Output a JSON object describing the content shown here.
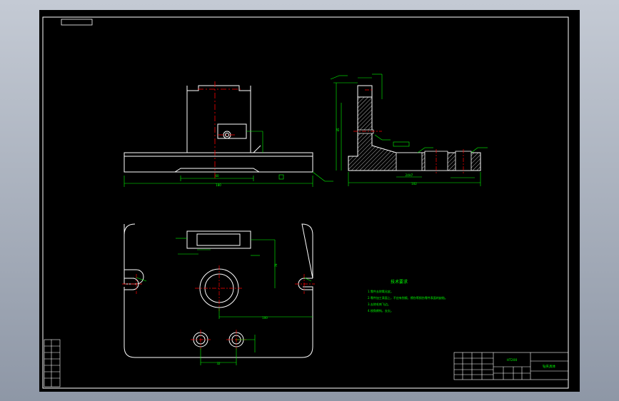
{
  "drawing": {
    "technical_requirements": {
      "heading": "技术要求",
      "items": [
        "1.零件去除氧化皮。",
        "2.零件加工表面上，不应有划痕、擦伤等损伤零件表面的缺陷。",
        "3.去除毛刺飞边。",
        "4.锐角倒钝，去尖。"
      ]
    },
    "title_block": {
      "material": "HT200",
      "part_name": "钻夹具体"
    },
    "dimension_labels": {
      "front_width": "180",
      "front_slot": "60",
      "side_height": "45",
      "side_base": "102",
      "side_slot": "24H7",
      "plan_offset": "100",
      "plan_hole_spacing": "32",
      "plan_vertical": "78"
    },
    "colors": {
      "background": "#000000",
      "outline": "#ffffff",
      "dimension": "#00ff00",
      "centerline": "#ff0000",
      "hatch": "#ffffff"
    }
  }
}
